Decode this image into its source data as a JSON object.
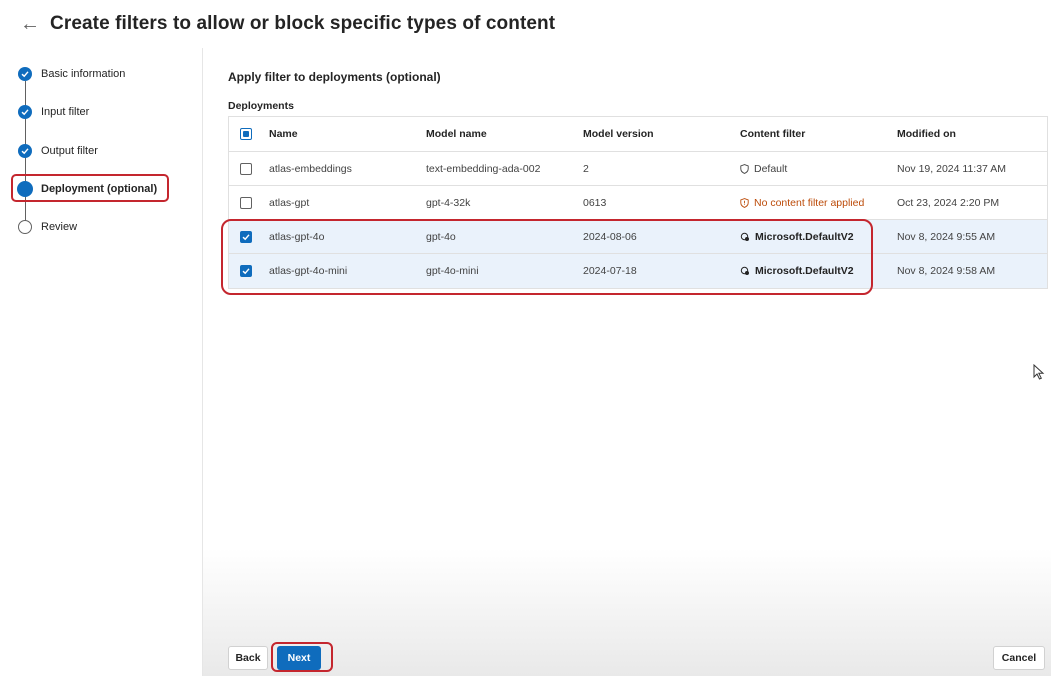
{
  "header": {
    "back_icon": "arrow-left-icon",
    "title": "Create filters to allow or block specific types of content"
  },
  "steps": [
    {
      "label": "Basic information",
      "status": "completed"
    },
    {
      "label": "Input filter",
      "status": "completed"
    },
    {
      "label": "Output filter",
      "status": "completed"
    },
    {
      "label": "Deployment (optional)",
      "status": "current"
    },
    {
      "label": "Review",
      "status": "pending"
    }
  ],
  "main": {
    "section_title": "Apply filter to deployments (optional)",
    "table_label": "Deployments",
    "columns": [
      "Name",
      "Model name",
      "Model version",
      "Content filter",
      "Modified on"
    ],
    "rows": [
      {
        "name": "atlas-embeddings",
        "model": "text-embedding-ada-002",
        "version": "2",
        "filter": "Default",
        "filter_icon": "shield-icon",
        "modified": "Nov 19, 2024 11:37 AM",
        "checked": false
      },
      {
        "name": "atlas-gpt",
        "model": "gpt-4-32k",
        "version": "0613",
        "filter": "No content filter applied",
        "filter_icon": "warning-shield-icon",
        "modified": "Oct 23, 2024 2:20 PM",
        "checked": false
      },
      {
        "name": "atlas-gpt-4o",
        "model": "gpt-4o",
        "version": "2024-08-06",
        "filter": "Microsoft.DefaultV2",
        "filter_icon": "filter-settings-icon",
        "modified": "Nov 8, 2024 9:55 AM",
        "checked": true
      },
      {
        "name": "atlas-gpt-4o-mini",
        "model": "gpt-4o-mini",
        "version": "2024-07-18",
        "filter": "Microsoft.DefaultV2",
        "filter_icon": "filter-settings-icon",
        "modified": "Nov 8, 2024 9:58 AM",
        "checked": true
      }
    ]
  },
  "footer": {
    "back_label": "Back",
    "next_label": "Next",
    "cancel_label": "Cancel"
  },
  "colors": {
    "accent": "#0f6cbd",
    "highlight": "#c4262e",
    "warning": "#bc4b09",
    "selected_row": "#eaf2fb"
  }
}
